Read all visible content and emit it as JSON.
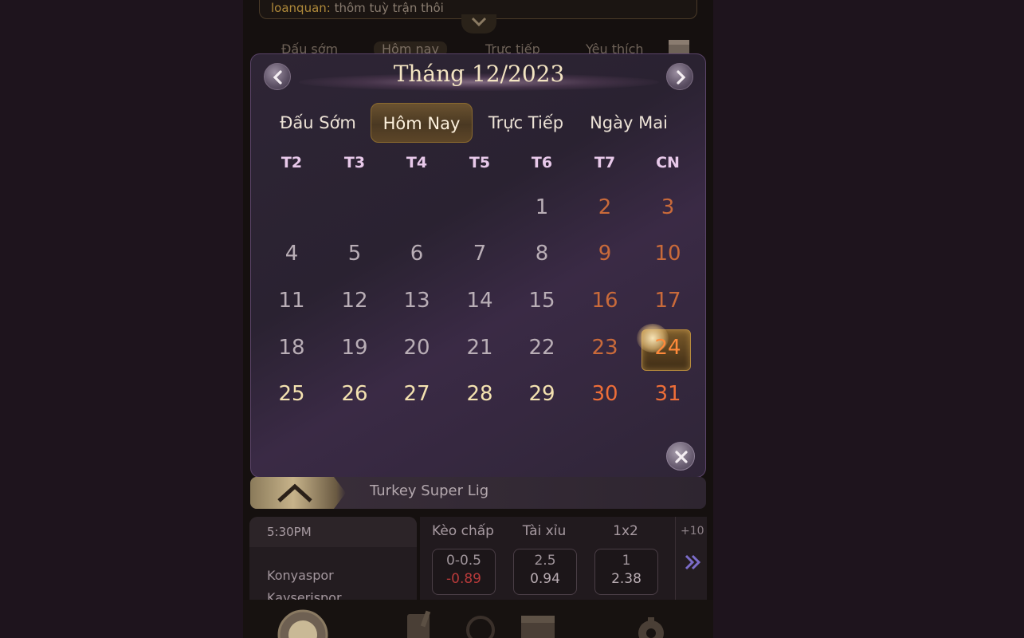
{
  "background": {
    "chat": {
      "user": "loanquan:",
      "message": "thôm tuỳ trận thôi"
    },
    "tabs": [
      "Đấu sớm",
      "Hôm nay",
      "Trực tiếp",
      "Yêu thích"
    ],
    "active_tab_index": 1
  },
  "calendar": {
    "title": "Tháng 12/2023",
    "quick_tabs": [
      "Đấu Sớm",
      "Hôm Nay",
      "Trực Tiếp",
      "Ngày Mai"
    ],
    "active_quick_tab": "Hôm Nay",
    "weekdays": [
      "T2",
      "T3",
      "T4",
      "T5",
      "T6",
      "T7",
      "CN"
    ],
    "first_day_column": 4,
    "days_in_month": 31,
    "selected_day": 24,
    "colors": {
      "weekend": "#c96a3a",
      "today": "#ff8a3a",
      "upcoming": "#f4e2b0"
    }
  },
  "league": {
    "name": "Turkey Super Lig"
  },
  "match": {
    "time": "5:30PM",
    "home": "Konyaspor",
    "away": "Kayserispor",
    "markets": [
      {
        "label": "Kèo chấp",
        "top": "0-0.5",
        "bottom": "-0.89",
        "bottom_negative": true
      },
      {
        "label": "Tài xỉu",
        "top": "2.5",
        "bottom": "0.94",
        "bottom_negative": false
      },
      {
        "label": "1x2",
        "top": "1",
        "bottom": "2.38",
        "bottom_negative": false
      }
    ],
    "more": "+10"
  }
}
